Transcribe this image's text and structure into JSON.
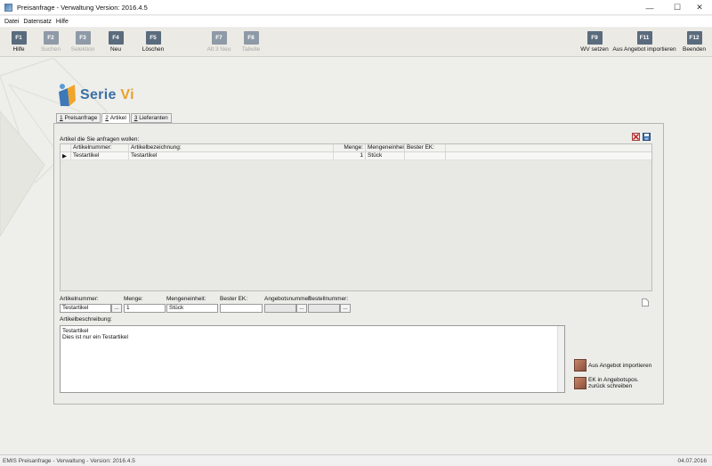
{
  "window": {
    "title": "Preisanfrage - Verwaltung Version: 2016.4.5"
  },
  "menu": [
    "Datei",
    "Datensatz",
    "Hilfe"
  ],
  "toolbar": [
    {
      "key": "F1",
      "label": "Hilfe",
      "enabled": true
    },
    {
      "key": "F2",
      "label": "Suchen",
      "enabled": false
    },
    {
      "key": "F3",
      "label": "Selektion",
      "enabled": false
    },
    {
      "key": "F4",
      "label": "Neu",
      "enabled": true
    },
    {
      "key": "F5",
      "label": "Löschen",
      "enabled": true
    },
    {
      "key": "F7",
      "label": "Alt 3 Neu",
      "enabled": false
    },
    {
      "key": "F8",
      "label": "Tabelle",
      "enabled": false
    },
    {
      "key": "F9",
      "label": "WV setzen",
      "enabled": true
    },
    {
      "key": "F11",
      "label": "Aus Angebot importieren",
      "enabled": true
    },
    {
      "key": "F12",
      "label": "Beenden",
      "enabled": true
    }
  ],
  "logo": {
    "text_main": "Serie",
    "text_accent": "Vi"
  },
  "tabs": [
    {
      "num": "1",
      "label": "Preisanfrage"
    },
    {
      "num": "2",
      "label": "Artikel"
    },
    {
      "num": "3",
      "label": "Lieferanten"
    }
  ],
  "articles": {
    "caption": "Artikel die Sie anfragen wollen:",
    "columns": [
      "Artikelnummer:",
      "Artikelbezeichnung:",
      "Menge:",
      "Mengeneinheit:",
      "Bester EK:"
    ],
    "rows": [
      {
        "nummer": "Testartikel",
        "bezeichnung": "Testartikel",
        "menge": "1",
        "einheit": "Stück",
        "ek": ""
      }
    ]
  },
  "fields": {
    "artikelnummer_label": "Artikelnummer:",
    "artikelnummer_value": "Testartikel",
    "menge_label": "Menge:",
    "menge_value": "1",
    "einheit_label": "Mengeneinheit:",
    "einheit_value": "Stück",
    "ek_label": "Bester EK:",
    "ek_value": "",
    "angebot_label": "Angebotsnummer:",
    "angebot_value": "",
    "bestell_label": "Bestellnummer:",
    "bestell_value": "",
    "ellipsis": "...",
    "beschreibung_label": "Artikelbeschreibung:",
    "beschreibung_line1": "Testartikel",
    "beschreibung_line2": "Dies ist nur ein Testartikel"
  },
  "side_buttons": {
    "import_label": "Aus Angebot importieren",
    "ek_line1": "EK in Angebotspos.",
    "ek_line2": "zurück schreiben"
  },
  "status": {
    "left": "EMIS Preisanfrage - Verwaltung - Version: 2016.4.5",
    "right": "04.07.2016"
  }
}
